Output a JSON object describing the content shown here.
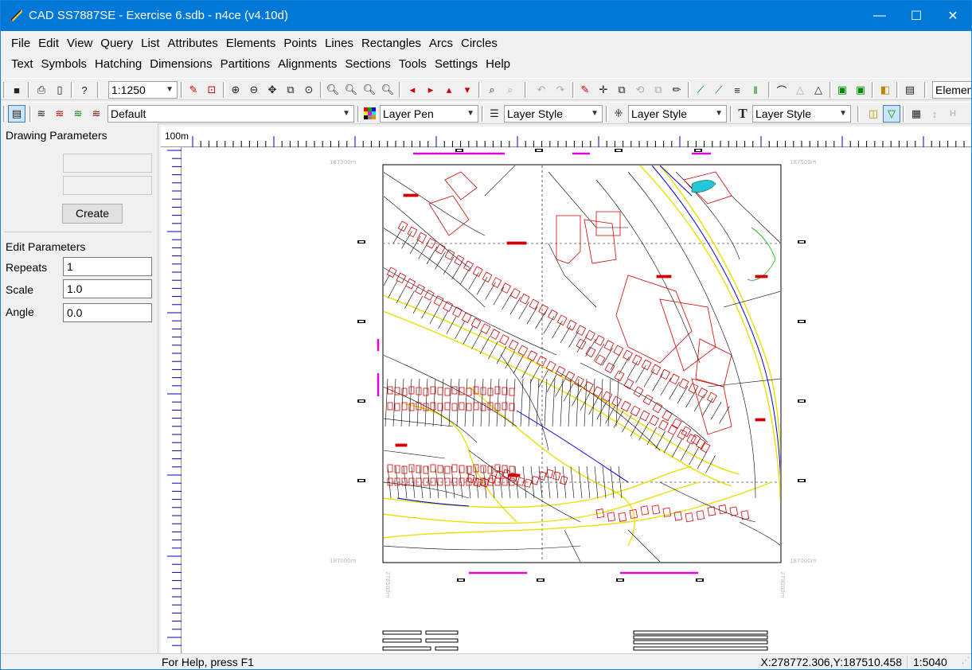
{
  "window": {
    "title": "CAD SS7887SE - Exercise 6.sdb - n4ce (v4.10d)",
    "minimize_glyph": "—",
    "maximize_glyph": "☐",
    "close_glyph": "✕"
  },
  "menu": {
    "row1": [
      "File",
      "Edit",
      "View",
      "Query",
      "List",
      "Attributes",
      "Elements",
      "Points",
      "Lines",
      "Rectangles",
      "Arcs",
      "Circles"
    ],
    "row2": [
      "Text",
      "Symbols",
      "Hatching",
      "Dimensions",
      "Partitions",
      "Alignments",
      "Sections",
      "Tools",
      "Settings",
      "Help"
    ]
  },
  "toolbar1": {
    "scale_value": "1:1250",
    "elements_label": "Elemen"
  },
  "toolbar2": {
    "layer_value": "Default",
    "pen_value": "Layer Pen",
    "line_style_value": "Layer Style",
    "symbol_style_value": "Layer Style",
    "text_style_value": "Layer Style",
    "text_icon_glyph": "T"
  },
  "left_panel": {
    "drawing_params_title": "Drawing Parameters",
    "create_label": "Create",
    "edit_params_title": "Edit Parameters",
    "repeats_label": "Repeats",
    "repeats_value": "1",
    "scale_label": "Scale",
    "scale_value": "1.0",
    "angle_label": "Angle",
    "angle_value": "0.0"
  },
  "ruler": {
    "top_label": "100m"
  },
  "drawing": {
    "grid_label_tl": "187500m",
    "grid_label_tr": "187500m",
    "grid_label_bl": "187000m",
    "grid_label_br": "187000m",
    "grid_label_bottom_left": "278500m",
    "grid_label_bottom_right": "279000m"
  },
  "status": {
    "help_text": "For Help, press F1",
    "coords": "X:278772.306,Y:187510.458",
    "scale": "1:5040"
  }
}
